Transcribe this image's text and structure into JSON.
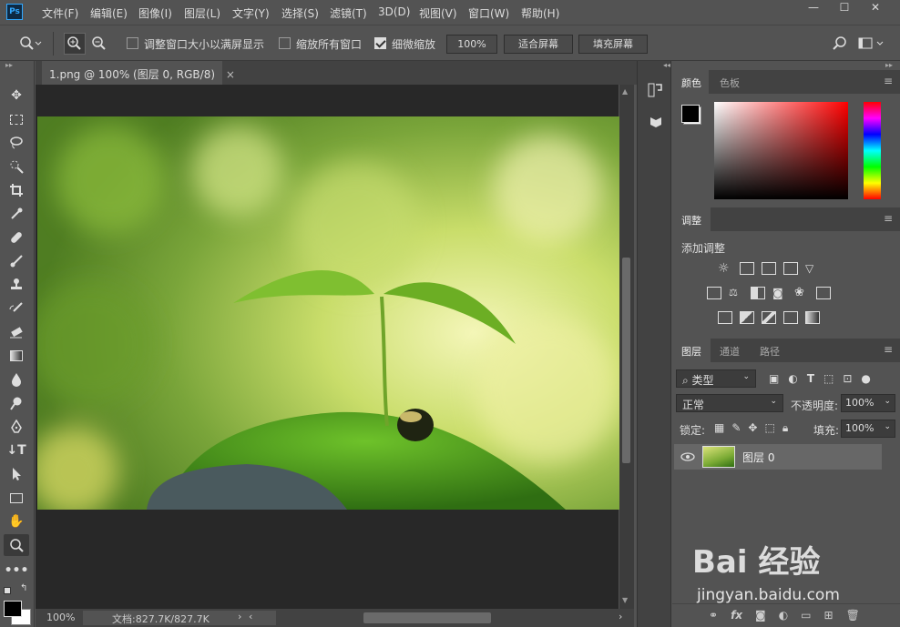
{
  "app": {
    "logo": "Ps"
  },
  "menu": [
    "文件(F)",
    "编辑(E)",
    "图像(I)",
    "图层(L)",
    "文字(Y)",
    "选择(S)",
    "滤镜(T)",
    "3D(D)",
    "视图(V)",
    "窗口(W)",
    "帮助(H)"
  ],
  "window_buttons": [
    "—",
    "☐",
    "✕"
  ],
  "options": {
    "resize_windows": "调整窗口大小以满屏显示",
    "zoom_all": "缩放所有窗口",
    "scrubby_zoom": "细微缩放",
    "zoom_value": "100%",
    "fit_screen": "适合屏幕",
    "fill_screen": "填充屏幕"
  },
  "document": {
    "tab": "1.png @ 100% (图层 0, RGB/8)",
    "close": "×"
  },
  "status": {
    "zoom": "100%",
    "doc": "文档:827.7K/827.7K"
  },
  "panels": {
    "color_tabs": [
      "颜色",
      "色板"
    ],
    "adjust_tab": "调整",
    "adjust_title": "添加调整",
    "layer_tabs": [
      "图层",
      "通道",
      "路径"
    ],
    "filter_kind": "类型",
    "blend_mode": "正常",
    "opacity_label": "不透明度:",
    "opacity": "100%",
    "lock_label": "锁定:",
    "fill_label": "填充:",
    "fill": "100%",
    "layer_name": "图层 0"
  },
  "colors": {
    "foreground": "#000000",
    "background": "#ffffff",
    "accent": "#31a8ff"
  },
  "watermark": {
    "brand": "Bai 经验",
    "url": "jingyan.baidu.com"
  }
}
